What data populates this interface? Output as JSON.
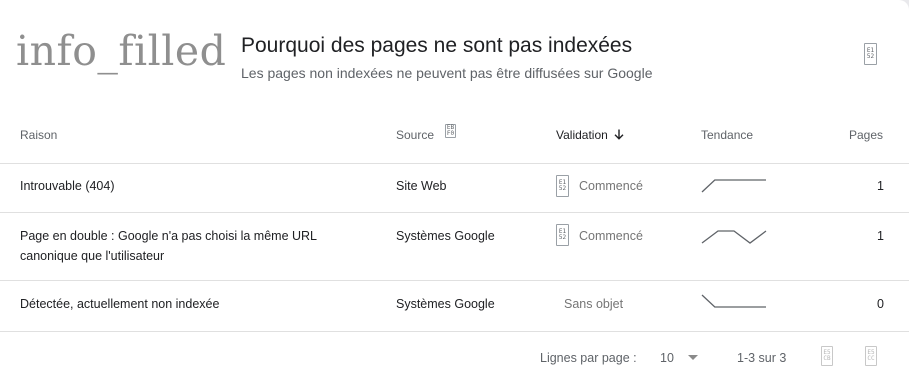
{
  "header": {
    "icon_text": "info_filled",
    "title": "Pourquoi des pages ne sont pas indexées",
    "subtitle": "Les pages non indexées ne peuvent pas être diffusées sur Google",
    "action_glyph": [
      "E1",
      "52"
    ]
  },
  "table": {
    "columns": {
      "reason": "Raison",
      "source": "Source",
      "source_glyph": [
        "EB",
        "F0"
      ],
      "validation": "Validation",
      "trend": "Tendance",
      "pages": "Pages"
    },
    "rows": [
      {
        "reason": "Introuvable (404)",
        "source": "Site Web",
        "validation": "Commencé",
        "validation_glyph": [
          "E1",
          "52"
        ],
        "trend": [
          0,
          1,
          1,
          1,
          1,
          1
        ],
        "pages": "1"
      },
      {
        "reason_line1": "Page en double : Google n'a pas choisi la même URL",
        "reason_line2": "canonique que l'utilisateur",
        "source": "Systèmes Google",
        "validation": "Commencé",
        "validation_glyph": [
          "E1",
          "52"
        ],
        "trend": [
          0,
          1,
          1,
          0,
          1
        ],
        "pages": "1"
      },
      {
        "reason": "Détectée, actuellement non indexée",
        "source": "Systèmes Google",
        "validation": "Sans objet",
        "trend": [
          1,
          0,
          0,
          0,
          0,
          0
        ],
        "pages": "0"
      }
    ]
  },
  "pagination": {
    "rows_per_page_label": "Lignes par page :",
    "rows_per_page_value": "10",
    "range": "1-3 sur 3",
    "prev_glyph": [
      "E5",
      "CB"
    ],
    "next_glyph": [
      "E5",
      "CC"
    ]
  },
  "colors": {
    "line": "#e0e0e0",
    "sparkline": "#5f6368",
    "muted_text": "#757575"
  }
}
